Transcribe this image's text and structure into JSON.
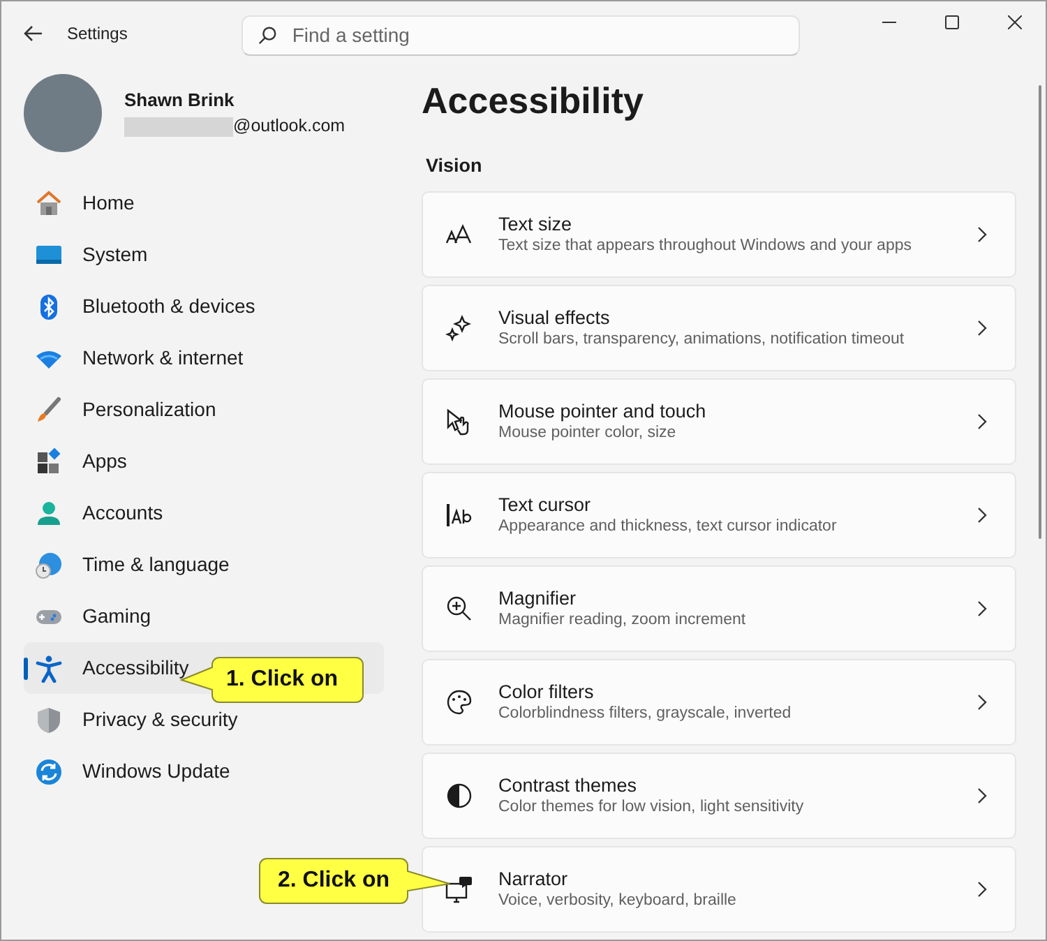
{
  "window": {
    "title": "Settings"
  },
  "search": {
    "placeholder": "Find a setting"
  },
  "profile": {
    "name": "Shawn Brink",
    "email": "@outlook.com"
  },
  "sidebar": {
    "items": [
      {
        "label": "Home",
        "selected": false
      },
      {
        "label": "System",
        "selected": false
      },
      {
        "label": "Bluetooth & devices",
        "selected": false
      },
      {
        "label": "Network & internet",
        "selected": false
      },
      {
        "label": "Personalization",
        "selected": false
      },
      {
        "label": "Apps",
        "selected": false
      },
      {
        "label": "Accounts",
        "selected": false
      },
      {
        "label": "Time & language",
        "selected": false
      },
      {
        "label": "Gaming",
        "selected": false
      },
      {
        "label": "Accessibility",
        "selected": true
      },
      {
        "label": "Privacy & security",
        "selected": false
      },
      {
        "label": "Windows Update",
        "selected": false
      }
    ]
  },
  "page": {
    "title": "Accessibility",
    "section": "Vision",
    "cards": [
      {
        "title": "Text size",
        "description": "Text size that appears throughout Windows and your apps"
      },
      {
        "title": "Visual effects",
        "description": "Scroll bars, transparency, animations, notification timeout"
      },
      {
        "title": "Mouse pointer and touch",
        "description": "Mouse pointer color, size"
      },
      {
        "title": "Text cursor",
        "description": "Appearance and thickness, text cursor indicator"
      },
      {
        "title": "Magnifier",
        "description": "Magnifier reading, zoom increment"
      },
      {
        "title": "Color filters",
        "description": "Colorblindness filters, grayscale, inverted"
      },
      {
        "title": "Contrast themes",
        "description": "Color themes for low vision, light sensitivity"
      },
      {
        "title": "Narrator",
        "description": "Voice, verbosity, keyboard, braille"
      }
    ]
  },
  "callouts": [
    {
      "text": "1. Click on"
    },
    {
      "text": "2. Click on"
    }
  ]
}
